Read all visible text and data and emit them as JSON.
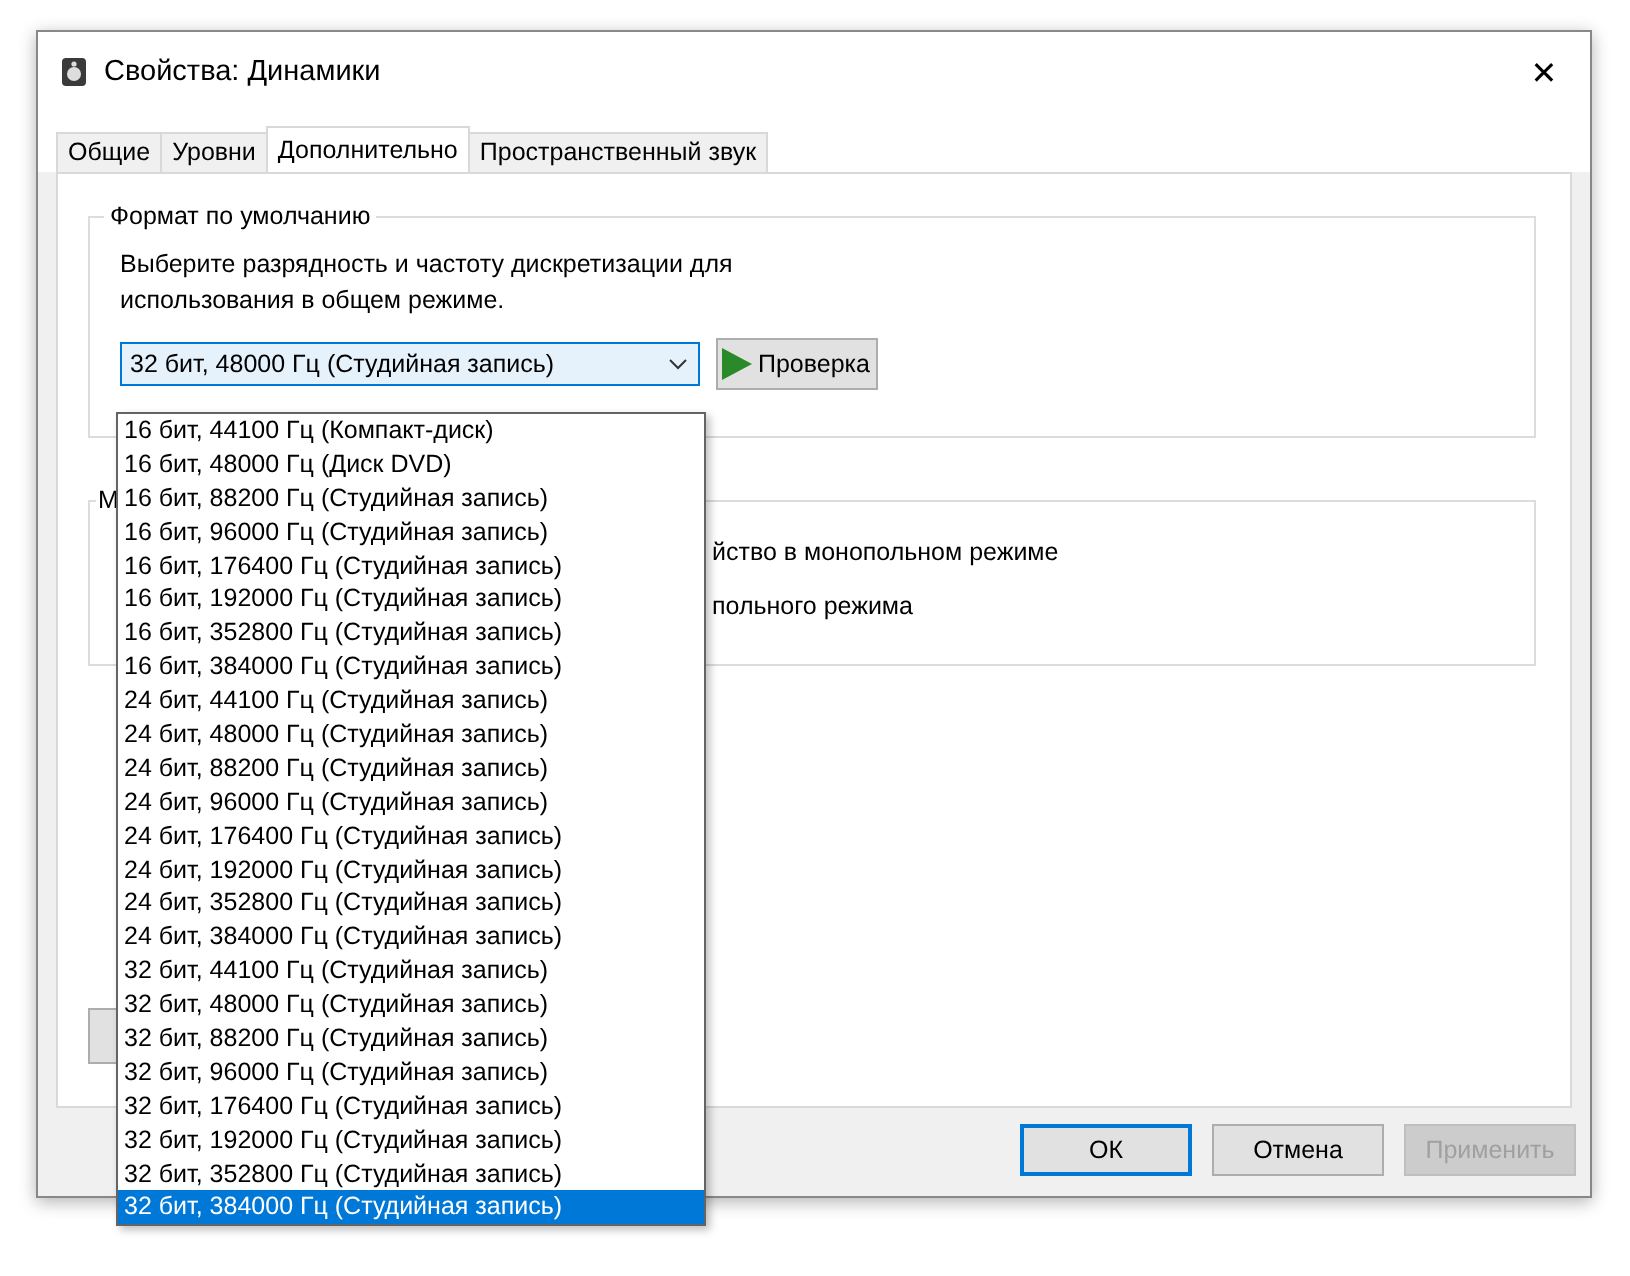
{
  "window": {
    "title": "Свойства: Динамики",
    "close": "✕"
  },
  "tabs": [
    {
      "label": "Общие",
      "selected": false
    },
    {
      "label": "Уровни",
      "selected": false
    },
    {
      "label": "Дополнительно",
      "selected": true
    },
    {
      "label": "Пространственный звук",
      "selected": false
    }
  ],
  "default_format": {
    "legend": "Формат по умолчанию",
    "description": "Выберите разрядность и частоту дискретизации для использования в общем режиме.",
    "combo_value": "32 бит, 48000 Гц (Студийная запись)",
    "test_button": "Проверка"
  },
  "exclusive_group": {
    "legend": "М",
    "lines": [
      "йство в монопольном режиме",
      "польного режима"
    ]
  },
  "dropdown_items": [
    {
      "label": "16 бит, 44100 Гц (Компакт-диск)",
      "selected": false
    },
    {
      "label": "16 бит, 48000 Гц (Диск DVD)",
      "selected": false
    },
    {
      "label": "16 бит, 88200 Гц (Студийная запись)",
      "selected": false
    },
    {
      "label": "16 бит, 96000 Гц (Студийная запись)",
      "selected": false
    },
    {
      "label": "16 бит, 176400 Гц (Студийная запись)",
      "selected": false
    },
    {
      "label": "16 бит, 192000 Гц (Студийная запись)",
      "selected": false
    },
    {
      "label": "16 бит, 352800 Гц (Студийная запись)",
      "selected": false
    },
    {
      "label": "16 бит, 384000 Гц (Студийная запись)",
      "selected": false
    },
    {
      "label": "24 бит, 44100 Гц (Студийная запись)",
      "selected": false
    },
    {
      "label": "24 бит, 48000 Гц (Студийная запись)",
      "selected": false
    },
    {
      "label": "24 бит, 88200 Гц (Студийная запись)",
      "selected": false
    },
    {
      "label": "24 бит, 96000 Гц (Студийная запись)",
      "selected": false
    },
    {
      "label": "24 бит, 176400 Гц (Студийная запись)",
      "selected": false
    },
    {
      "label": "24 бит, 192000 Гц (Студийная запись)",
      "selected": false
    },
    {
      "label": "24 бит, 352800 Гц (Студийная запись)",
      "selected": false
    },
    {
      "label": "24 бит, 384000 Гц (Студийная запись)",
      "selected": false
    },
    {
      "label": "32 бит, 44100 Гц (Студийная запись)",
      "selected": false
    },
    {
      "label": "32 бит, 48000 Гц (Студийная запись)",
      "selected": false
    },
    {
      "label": "32 бит, 88200 Гц (Студийная запись)",
      "selected": false
    },
    {
      "label": "32 бит, 96000 Гц (Студийная запись)",
      "selected": false
    },
    {
      "label": "32 бит, 176400 Гц (Студийная запись)",
      "selected": false
    },
    {
      "label": "32 бит, 192000 Гц (Студийная запись)",
      "selected": false
    },
    {
      "label": "32 бит, 352800 Гц (Студийная запись)",
      "selected": false
    },
    {
      "label": "32 бит, 384000 Гц (Студийная запись)",
      "selected": true
    }
  ],
  "buttons": [
    {
      "label": "ОК",
      "kind": "default",
      "disabled": false
    },
    {
      "label": "Отмена",
      "kind": "normal",
      "disabled": false
    },
    {
      "label": "Применить",
      "kind": "normal",
      "disabled": true
    }
  ]
}
